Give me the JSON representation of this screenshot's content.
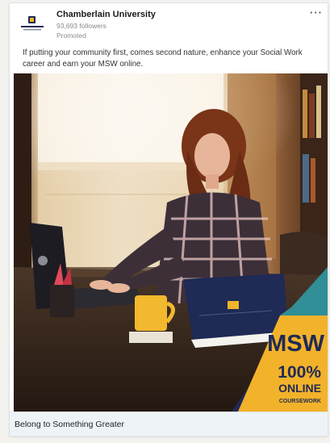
{
  "advertiser": {
    "name": "Chamberlain University",
    "followers": "93,693 followers",
    "sponsored_label": "Promoted",
    "logo_icon": "chamberlain-logo-icon"
  },
  "post": {
    "text": "If putting your community first, comes second nature, enhance your Social Work career and earn your MSW online."
  },
  "creative": {
    "headline": "MSW",
    "percent": "100%",
    "online": "ONLINE",
    "coursework": "COURSEWORK",
    "colors": {
      "navy": "#1f2a55",
      "teal": "#2f8e97",
      "gold": "#f2b22a"
    }
  },
  "cta": {
    "title": "Belong to Something Greater"
  },
  "menu": {
    "more_icon": "ellipsis-icon",
    "more_label": "···"
  }
}
